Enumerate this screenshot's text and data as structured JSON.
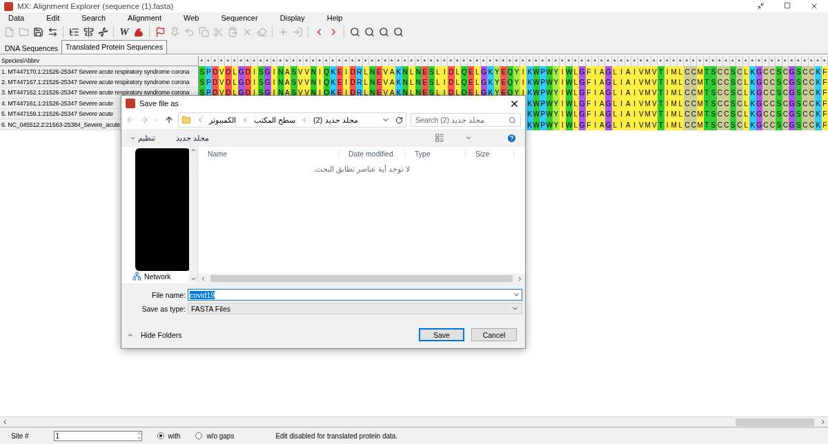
{
  "window": {
    "title": "MX: Alignment Explorer (sequence (1).fasta)"
  },
  "menu": [
    "Data",
    "Edit",
    "Search",
    "Alignment",
    "Web",
    "Sequencer",
    "Display",
    "Help"
  ],
  "toolbar": [
    {
      "kind": "new",
      "disabled": true
    },
    {
      "kind": "open",
      "disabled": true
    },
    {
      "kind": "save",
      "disabled": false
    },
    {
      "kind": "translate",
      "disabled": false
    },
    {
      "kind": "sep"
    },
    {
      "kind": "clustal",
      "disabled": false
    },
    {
      "kind": "muscle",
      "disabled": false
    },
    {
      "kind": "dna",
      "disabled": false
    },
    {
      "kind": "sep"
    },
    {
      "kind": "web",
      "glyph": "W",
      "disabled": false
    },
    {
      "kind": "arm",
      "disabled": false
    },
    {
      "kind": "sep"
    },
    {
      "kind": "flag",
      "disabled": false
    },
    {
      "kind": "site",
      "disabled": true
    },
    {
      "kind": "undo",
      "disabled": true
    },
    {
      "kind": "copy",
      "disabled": true
    },
    {
      "kind": "cut",
      "disabled": true
    },
    {
      "kind": "paste",
      "disabled": true
    },
    {
      "kind": "delete",
      "disabled": true
    },
    {
      "kind": "clear",
      "disabled": true
    },
    {
      "kind": "sep"
    },
    {
      "kind": "add",
      "disabled": true
    },
    {
      "kind": "insert",
      "disabled": true
    },
    {
      "kind": "sep"
    },
    {
      "kind": "prev",
      "disabled": false
    },
    {
      "kind": "next",
      "disabled": false
    },
    {
      "kind": "sep"
    },
    {
      "kind": "find",
      "disabled": false
    },
    {
      "kind": "find",
      "disabled": false
    },
    {
      "kind": "find",
      "disabled": false
    },
    {
      "kind": "find",
      "disabled": false
    }
  ],
  "tabs": [
    {
      "label": "DNA Sequences",
      "selected": false
    },
    {
      "label": "Translated Protein Sequences",
      "selected": true
    }
  ],
  "alignment": {
    "header": "Species/Abbrv",
    "columns": [
      {
        "mark": "*",
        "color": "#33cc33"
      },
      {
        "mark": "*",
        "color": "#33ccff"
      },
      {
        "mark": "*",
        "color": "#ff5555"
      },
      {
        "mark": "*",
        "color": "#ffee44"
      },
      {
        "mark": "*",
        "color": "#ff5555"
      },
      {
        "mark": "*",
        "color": "#ffee44"
      },
      {
        "mark": "*",
        "color": "#aa55ee"
      },
      {
        "mark": "*",
        "color": "#ff5555"
      },
      {
        "mark": "*",
        "color": "#ffee44"
      },
      {
        "mark": "*",
        "color": "#33cc33"
      },
      {
        "mark": "*",
        "color": "#aa55ee"
      },
      {
        "mark": "*",
        "color": "#ffee44"
      },
      {
        "mark": "*",
        "color": "#33cc33"
      },
      {
        "mark": "*",
        "color": "#ffee44"
      },
      {
        "mark": "*",
        "color": "#33cc33"
      },
      {
        "mark": "*",
        "color": "#ffee44"
      },
      {
        "mark": "*",
        "color": "#ffee44"
      },
      {
        "mark": "*",
        "color": "#33cc33"
      },
      {
        "mark": "*",
        "color": "#ffee44"
      },
      {
        "mark": "*",
        "color": "#33cc33"
      },
      {
        "mark": "*",
        "color": "#33ccff"
      },
      {
        "mark": "*",
        "color": "#ff5555"
      },
      {
        "mark": "*",
        "color": "#ffee44"
      },
      {
        "mark": "*",
        "color": "#ff5555"
      },
      {
        "mark": "*",
        "color": "#33ccff"
      },
      {
        "mark": "*",
        "color": "#ffee44"
      },
      {
        "mark": "*",
        "color": "#33cc33"
      },
      {
        "mark": "*",
        "color": "#ff5555"
      },
      {
        "mark": "*",
        "color": "#ffee44"
      },
      {
        "mark": "*",
        "color": "#ffee44"
      },
      {
        "mark": "*",
        "color": "#33ccff"
      },
      {
        "mark": "*",
        "color": "#33cc33"
      },
      {
        "mark": "*",
        "color": "#ffee44"
      },
      {
        "mark": "*",
        "color": "#33cc33"
      },
      {
        "mark": "*",
        "color": "#ff5555"
      },
      {
        "mark": "*",
        "color": "#33cc33"
      },
      {
        "mark": "*",
        "color": "#ffee44"
      },
      {
        "mark": "*",
        "color": "#ffee44"
      },
      {
        "mark": "*",
        "color": "#ff5555"
      },
      {
        "mark": "*",
        "color": "#ffee44"
      },
      {
        "mark": "*",
        "color": "#33cc33"
      },
      {
        "mark": "*",
        "color": "#ff5555"
      },
      {
        "mark": "*",
        "color": "#ffee44"
      },
      {
        "mark": "*",
        "color": "#aa55ee"
      },
      {
        "mark": "*",
        "color": "#33ccff"
      },
      {
        "mark": "*",
        "color": "#aaee44"
      },
      {
        "mark": "*",
        "color": "#ff5555"
      },
      {
        "mark": "*",
        "color": "#33cc33"
      },
      {
        "mark": "*",
        "color": "#aaee44"
      },
      {
        "mark": "*",
        "color": "#ffee44"
      },
      {
        "mark": "*",
        "color": "#33ccff"
      },
      {
        "mark": "*",
        "color": "#33cc33"
      },
      {
        "mark": "*",
        "color": "#33ccff"
      },
      {
        "mark": "*",
        "color": "#33cc33"
      },
      {
        "mark": "*",
        "color": "#aaee44"
      },
      {
        "mark": "*",
        "color": "#ffee44"
      },
      {
        "mark": "*",
        "color": "#33cc33"
      },
      {
        "mark": "*",
        "color": "#ffee44"
      },
      {
        "mark": "*",
        "color": "#aa55ee"
      },
      {
        "mark": "*",
        "color": "#ffee44"
      },
      {
        "mark": "*",
        "color": "#ffee44"
      },
      {
        "mark": "*",
        "color": "#ffee44"
      },
      {
        "mark": "*",
        "color": "#aa55ee"
      },
      {
        "mark": "*",
        "color": "#ffee44"
      },
      {
        "mark": "*",
        "color": "#ffee44"
      },
      {
        "mark": "*",
        "color": "#ffee44"
      },
      {
        "mark": "*",
        "color": "#ffee44"
      },
      {
        "mark": "*",
        "color": "#ffee44"
      },
      {
        "mark": "*",
        "color": "#ffee44"
      },
      {
        "mark": "*",
        "color": "#ffee44"
      },
      {
        "mark": "*",
        "color": "#33cc33"
      },
      {
        "mark": "*",
        "color": "#ffee44"
      },
      {
        "mark": "*",
        "color": "#ffee44"
      },
      {
        "mark": "*",
        "color": "#ffee44"
      },
      {
        "mark": "*",
        "color": "#cccc99"
      },
      {
        "mark": "*",
        "color": "#cccc99"
      },
      {
        "mark": "*",
        "color": "#ffee44"
      },
      {
        "mark": "*",
        "color": "#33cc33"
      },
      {
        "mark": "*",
        "color": "#33cc33"
      },
      {
        "mark": "*",
        "color": "#cccc99"
      },
      {
        "mark": "*",
        "color": "#cccc99"
      },
      {
        "mark": "*",
        "color": "#33cc33"
      },
      {
        "mark": "*",
        "color": "#cccc99"
      },
      {
        "mark": "*",
        "color": "#ffee44"
      },
      {
        "mark": "*",
        "color": "#33ccff"
      },
      {
        "mark": "*",
        "color": "#aa55ee"
      },
      {
        "mark": "*",
        "color": "#cccc99"
      },
      {
        "mark": "*",
        "color": "#cccc99"
      },
      {
        "mark": "*",
        "color": "#33cc33"
      },
      {
        "mark": "*",
        "color": "#cccc99"
      },
      {
        "mark": "*",
        "color": "#aa55ee"
      },
      {
        "mark": "*",
        "color": "#33cc33"
      },
      {
        "mark": "*",
        "color": "#cccc99"
      },
      {
        "mark": "*",
        "color": "#cccc99"
      },
      {
        "mark": "*",
        "color": "#33ccff"
      },
      {
        "mark": "*",
        "color": "#ffee44"
      }
    ],
    "rows": [
      {
        "name": "1. MT447170.1:21526-25347 Severe acute respiratory syndrome corona",
        "residues": [
          "S",
          "P",
          "D",
          "V",
          "D",
          "L",
          "G",
          "D",
          "I",
          "S",
          "G",
          "I",
          "N",
          "A",
          "S",
          "V",
          "V",
          "N",
          "I",
          "Q",
          "K",
          "E",
          "I",
          "D",
          "R",
          "L",
          "N",
          "E",
          "V",
          "A",
          "K",
          "N",
          "L",
          "N",
          "E",
          "S",
          "L",
          "I",
          "D",
          "L",
          "Q",
          "E",
          "L",
          "G",
          "K",
          "Y",
          "E",
          "Q",
          "Y",
          "I",
          "K",
          "W",
          "P",
          "W",
          "Y",
          "I",
          "W",
          "L",
          "G",
          "F",
          "I",
          "A",
          "G",
          "L",
          "I",
          "A",
          "I",
          "V",
          "M",
          "V",
          "T",
          "I",
          "M",
          "L",
          "C",
          "C",
          "M",
          "T",
          "S",
          "C",
          "C",
          "S",
          "C",
          "L",
          "K",
          "G",
          "C",
          "C",
          "S",
          "C",
          "G",
          "S",
          "C",
          "C",
          "K",
          "F"
        ]
      },
      {
        "name": "2. MT447167.1:21526-25347 Severe acute respiratory syndrome corona",
        "residues": [
          "S",
          "P",
          "D",
          "V",
          "D",
          "L",
          "G",
          "D",
          "I",
          "S",
          "G",
          "I",
          "N",
          "A",
          "S",
          "V",
          "V",
          "N",
          "I",
          "Q",
          "K",
          "E",
          "I",
          "D",
          "R",
          "L",
          "N",
          "E",
          "V",
          "A",
          "K",
          "N",
          "L",
          "N",
          "E",
          "S",
          "L",
          "I",
          "D",
          "L",
          "Q",
          "E",
          "L",
          "G",
          "K",
          "Y",
          "E",
          "Q",
          "Y",
          "I",
          "K",
          "W",
          "P",
          "W",
          "Y",
          "I",
          "W",
          "L",
          "G",
          "F",
          "I",
          "A",
          "G",
          "L",
          "I",
          "A",
          "I",
          "V",
          "M",
          "V",
          "T",
          "I",
          "M",
          "L",
          "C",
          "C",
          "M",
          "T",
          "S",
          "C",
          "C",
          "S",
          "C",
          "L",
          "K",
          "G",
          "C",
          "C",
          "S",
          "C",
          "G",
          "S",
          "C",
          "C",
          "K",
          "F"
        ]
      },
      {
        "name": "3. MT447162.1:21526-25347 Severe acute respiratory syndrome corona",
        "residues": [
          "S",
          "P",
          "D",
          "V",
          "D",
          "L",
          "G",
          "D",
          "I",
          "S",
          "G",
          "I",
          "N",
          "A",
          "S",
          "V",
          "V",
          "N",
          "I",
          "Q",
          "K",
          "E",
          "I",
          "D",
          "R",
          "L",
          "N",
          "E",
          "V",
          "A",
          "K",
          "N",
          "L",
          "N",
          "E",
          "S",
          "L",
          "I",
          "D",
          "L",
          "Q",
          "E",
          "L",
          "G",
          "K",
          "Y",
          "E",
          "Q",
          "Y",
          "I",
          "K",
          "W",
          "P",
          "W",
          "Y",
          "I",
          "W",
          "L",
          "G",
          "F",
          "I",
          "A",
          "G",
          "L",
          "I",
          "A",
          "I",
          "V",
          "M",
          "V",
          "T",
          "I",
          "M",
          "L",
          "C",
          "C",
          "M",
          "T",
          "S",
          "C",
          "C",
          "S",
          "C",
          "L",
          "K",
          "G",
          "C",
          "C",
          "S",
          "C",
          "G",
          "S",
          "C",
          "C",
          "K",
          "F"
        ]
      },
      {
        "name": "4. MT447161.1:21526-25347 Severe acute",
        "residues": [
          "K",
          "W",
          "P",
          "W",
          "Y",
          "I",
          "W",
          "L",
          "G",
          "F",
          "I",
          "A",
          "G",
          "L",
          "I",
          "A",
          "I",
          "V",
          "M",
          "V",
          "T",
          "I",
          "M",
          "L",
          "C",
          "C",
          "M",
          "T",
          "S",
          "C",
          "C",
          "S",
          "C",
          "L",
          "K",
          "G",
          "C",
          "C",
          "S",
          "C",
          "G",
          "S",
          "C",
          "C",
          "K",
          "F"
        ]
      },
      {
        "name": "5. MT447159.1:21526-25347 Severe acute",
        "residues": [
          "K",
          "W",
          "P",
          "W",
          "Y",
          "I",
          "W",
          "L",
          "G",
          "F",
          "I",
          "A",
          "G",
          "L",
          "I",
          "A",
          "I",
          "V",
          "M",
          "V",
          "T",
          "I",
          "M",
          "L",
          "C",
          "C",
          "M",
          "T",
          "S",
          "C",
          "C",
          "S",
          "C",
          "L",
          "K",
          "G",
          "C",
          "C",
          "S",
          "C",
          "G",
          "S",
          "C",
          "C",
          "K",
          "F"
        ]
      },
      {
        "name": "6. NC_045512.2:21563-25384_Severe_acute",
        "residues": [
          "K",
          "W",
          "P",
          "W",
          "Y",
          "I",
          "W",
          "L",
          "G",
          "F",
          "I",
          "A",
          "G",
          "L",
          "I",
          "A",
          "I",
          "V",
          "M",
          "V",
          "T",
          "I",
          "M",
          "L",
          "C",
          "C",
          "M",
          "T",
          "S",
          "C",
          "C",
          "S",
          "C",
          "L",
          "K",
          "G",
          "C",
          "C",
          "S",
          "C",
          "G",
          "S",
          "C",
          "C",
          "K",
          "F"
        ]
      }
    ]
  },
  "dialog": {
    "title": "Save file as",
    "breadcrumb": [
      "مجلد جديد (2)",
      "سطح المكتب",
      "الكمبيوتر"
    ],
    "search_placeholder": "Search مجلد جديد (2)",
    "organize": "تنظيم",
    "new_folder": "مجلد جديد",
    "columns": [
      "Name",
      "Date modified",
      "Type",
      "Size"
    ],
    "empty_message": "لا توجد أية عناصر تطابق البحث.",
    "nav_items": [
      {
        "label": "Network"
      }
    ],
    "file_name_label": "File name:",
    "file_name": "covid19",
    "type_label": "Save as type:",
    "type_value": "FASTA Files",
    "hide_folders": "Hide Folders",
    "buttons": [
      "Save",
      "Cancel"
    ]
  },
  "status": {
    "site_label": "Site #",
    "site_value": "1",
    "radios": [
      {
        "label": "with",
        "selected": true
      },
      {
        "label": "w/o gaps",
        "selected": false
      }
    ],
    "message": "Edit disabled for translated protein data."
  }
}
